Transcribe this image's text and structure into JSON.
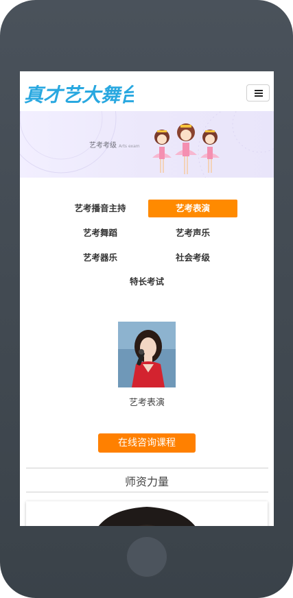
{
  "brand": {
    "logo_text": "真才艺大舞台",
    "logo_color": "#29a8e0"
  },
  "menu": {
    "icon": "hamburger-menu-icon"
  },
  "banner": {
    "title": "艺考考级",
    "subtitle": "Arts exam"
  },
  "categories": [
    {
      "label": "艺考播音主持",
      "active": false
    },
    {
      "label": "艺考表演",
      "active": true
    },
    {
      "label": "艺考舞蹈",
      "active": false
    },
    {
      "label": "艺考声乐",
      "active": false
    },
    {
      "label": "艺考器乐",
      "active": false
    },
    {
      "label": "社会考级",
      "active": false
    },
    {
      "label": "特长考试",
      "active": false
    }
  ],
  "featured": {
    "caption": "艺考表演"
  },
  "consult": {
    "label": "在线咨询课程"
  },
  "faculty": {
    "title": "师资力量"
  },
  "colors": {
    "accent": "#ff8000",
    "active_tab": "#ff8a00",
    "frame": "#434b53"
  }
}
